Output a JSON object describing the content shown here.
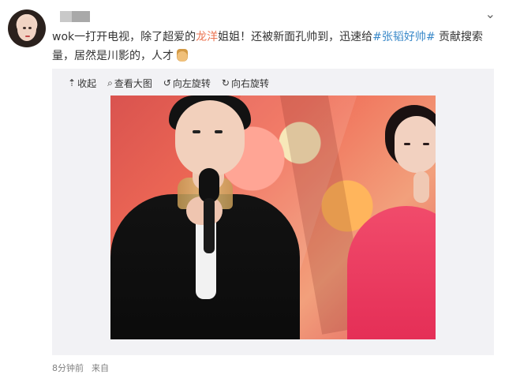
{
  "post": {
    "text_parts": [
      {
        "text": "wok一打开电视，除了超爱的",
        "type": "plain"
      },
      {
        "text": "龙洋",
        "type": "highlight"
      },
      {
        "text": "姐姐！还被新面孔帅到，迅速给",
        "type": "plain"
      },
      {
        "text": "#张韬好帅#",
        "type": "tag"
      },
      {
        "text": " 贡献搜索量，居然是川影的，人才",
        "type": "plain"
      }
    ]
  },
  "toolbar": {
    "collapse": "收起",
    "view_large": "查看大图",
    "rotate_left": "向左旋转",
    "rotate_right": "向右旋转"
  },
  "footer": {
    "time": "8分钟前",
    "source": "来自"
  },
  "icons": {
    "more": "chevron-down-icon",
    "collapse": "arrow-up-icon",
    "view_large": "magnifier-icon",
    "rotate_left": "rotate-left-icon",
    "rotate_right": "rotate-right-icon",
    "thumbs_up": "thumbs-up-emoji-icon"
  }
}
